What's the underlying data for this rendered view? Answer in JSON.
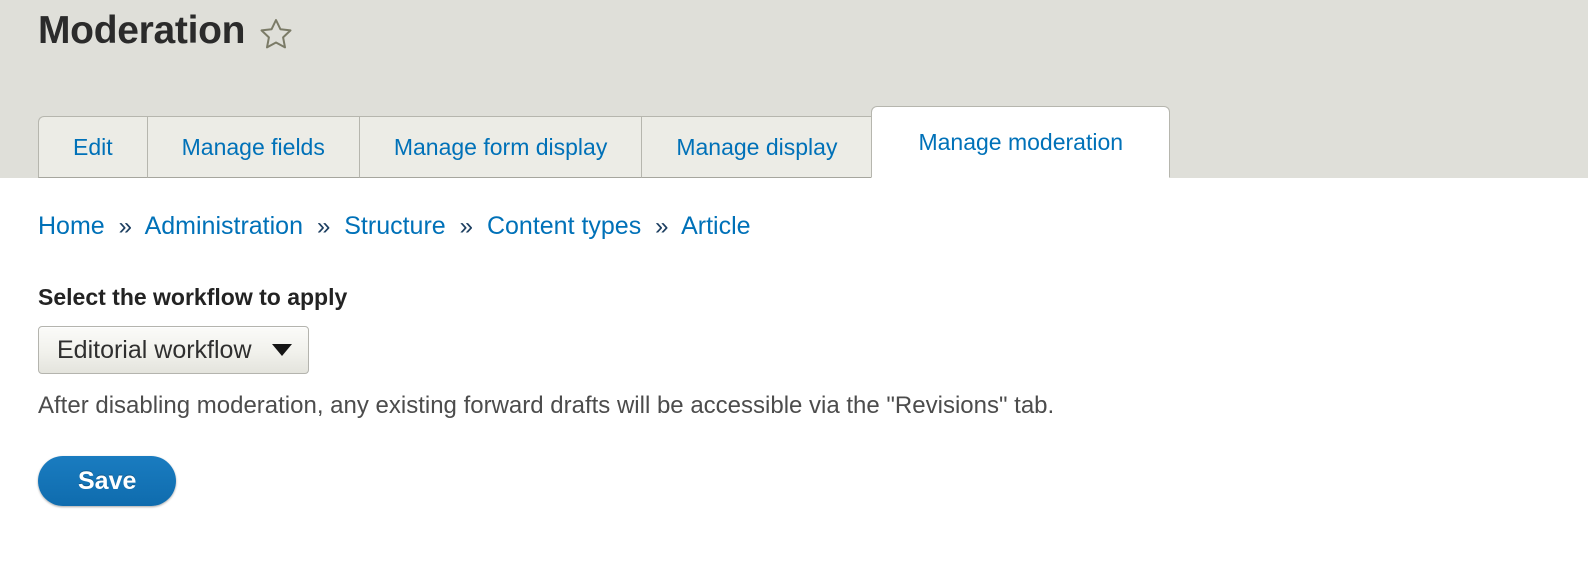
{
  "header": {
    "title": "Moderation",
    "star_icon": "star-outline-icon",
    "background_color": "#dfdfd9"
  },
  "tabs": [
    {
      "label": "Edit",
      "active": false
    },
    {
      "label": "Manage fields",
      "active": false
    },
    {
      "label": "Manage form display",
      "active": false
    },
    {
      "label": "Manage display",
      "active": false
    },
    {
      "label": "Manage moderation",
      "active": true
    }
  ],
  "breadcrumb": {
    "separator": "»",
    "items": [
      {
        "label": "Home"
      },
      {
        "label": "Administration"
      },
      {
        "label": "Structure"
      },
      {
        "label": "Content types"
      },
      {
        "label": "Article"
      }
    ]
  },
  "form": {
    "workflow_label": "Select the workflow to apply",
    "workflow_select": {
      "value": "Editorial workflow",
      "options": [
        "Editorial workflow"
      ],
      "arrow_icon": "chevron-down-icon"
    },
    "description": "After disabling moderation, any existing forward drafts will be accessible via the \"Revisions\" tab.",
    "save_label": "Save"
  },
  "colors": {
    "link_blue": "#0071b8",
    "breadcrumb_separator": "#1d3f61",
    "button_blue": "#0f6cae",
    "header_grey": "#dfdfd9",
    "tab_grey": "#ecece6",
    "star_outline": "#7b7b67"
  }
}
